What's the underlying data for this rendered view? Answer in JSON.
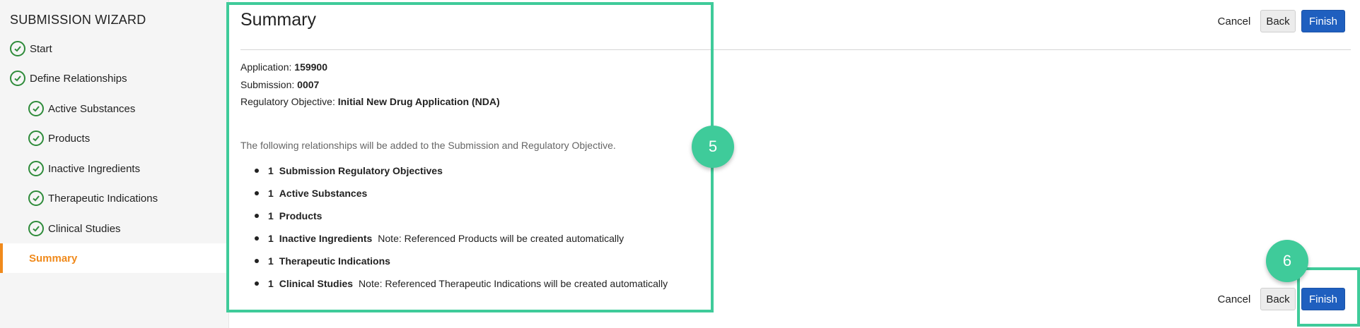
{
  "sidebar": {
    "title": "SUBMISSION WIZARD",
    "steps": [
      {
        "label": "Start"
      },
      {
        "label": "Define Relationships"
      },
      {
        "label": "Active Substances"
      },
      {
        "label": "Products"
      },
      {
        "label": "Inactive Ingredients"
      },
      {
        "label": "Therapeutic Indications"
      },
      {
        "label": "Clinical Studies"
      },
      {
        "label": "Summary"
      }
    ]
  },
  "main": {
    "title": "Summary",
    "application_label": "Application:",
    "application_value": "159900",
    "submission_label": "Submission:",
    "submission_value": "0007",
    "objective_label": "Regulatory Objective:",
    "objective_value": "Initial New Drug Application (NDA)",
    "lead_text": "The following relationships will be added to the Submission and Regulatory Objective.",
    "relationships": [
      {
        "count": "1",
        "label": "Submission Regulatory Objectives",
        "note": ""
      },
      {
        "count": "1",
        "label": "Active Substances",
        "note": ""
      },
      {
        "count": "1",
        "label": "Products",
        "note": ""
      },
      {
        "count": "1",
        "label": "Inactive Ingredients",
        "note": "Note: Referenced Products will be created automatically"
      },
      {
        "count": "1",
        "label": "Therapeutic Indications",
        "note": ""
      },
      {
        "count": "1",
        "label": "Clinical Studies",
        "note": "Note: Referenced Therapeutic Indications will be created automatically"
      }
    ]
  },
  "toolbar": {
    "cancel_label": "Cancel",
    "back_label": "Back",
    "finish_label": "Finish"
  },
  "annotations": {
    "badge_5": "5",
    "badge_6": "6",
    "color": "#3fcb9a"
  },
  "colors": {
    "accent_orange": "#f08a1c",
    "primary_blue": "#1f5fbf",
    "check_green": "#2e8b3a"
  }
}
